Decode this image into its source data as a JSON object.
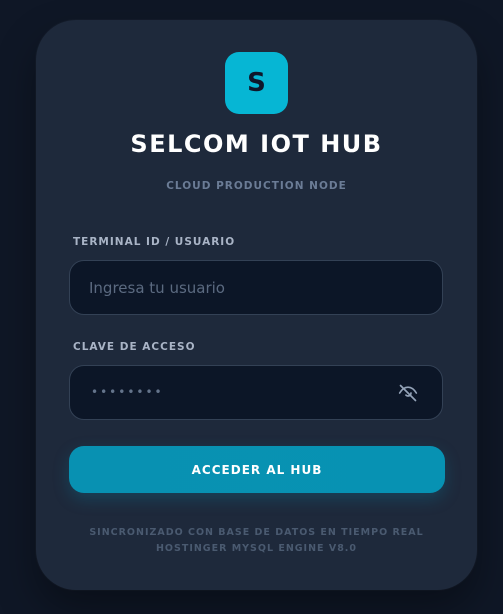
{
  "logo": {
    "letter": "S"
  },
  "header": {
    "title": "SELCOM IOT HUB",
    "subtitle": "CLOUD PRODUCTION NODE"
  },
  "form": {
    "user_label": "TERMINAL ID / USUARIO",
    "user_placeholder": "Ingresa tu usuario",
    "user_value": "",
    "password_label": "CLAVE DE ACCESO",
    "password_mask": "••••••••",
    "password_toggle_icon": "eye-off-icon",
    "submit_label": "ACCEDER AL HUB"
  },
  "footer": {
    "line1": "SINCRONIZADO CON BASE DE DATOS EN TIEMPO REAL",
    "line2": "HOSTINGER MYSQL ENGINE V8.0"
  },
  "colors": {
    "page_background": "#0f1726",
    "card_background": "#1e293b",
    "accent": "#06b6d4",
    "button": "#0891b2",
    "input_background": "#0c1627",
    "input_border": "#334155"
  }
}
